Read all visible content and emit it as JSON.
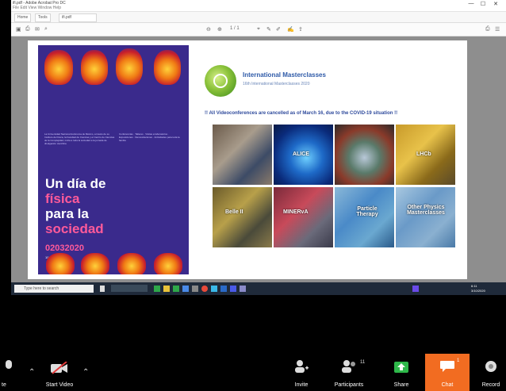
{
  "window": {
    "title": "ifi.pdf - Adobe Acrobat Pro DC",
    "menu": "File  Edit  View  Window  Help",
    "buttons": [
      "—",
      "☐",
      "✕"
    ]
  },
  "tabs": [
    {
      "label": "Home"
    },
    {
      "label": "Tools"
    },
    {
      "label": "ifi.pdf"
    }
  ],
  "toolbar": {
    "page_num": "1 / 1",
    "zoom": "☰"
  },
  "poster": {
    "intro": "La Universidad Nacional Autónoma de México, a través de su Instituto de Física, la Facultad de Ciencias y el Centro de Ciencias de la Complejidad, invita a toda la sociedad a la jornada de divulgación científica",
    "title_line1": "Un día de",
    "title_line2": "física",
    "title_line3": "para la",
    "title_line4": "sociedad",
    "date": "02032020",
    "time": "10:00",
    "details": "Conferencias · Talleres · Visitas a laboratorios · Exposiciones · Demostraciones · Actividades para toda la familia"
  },
  "masterclass": {
    "title": "International Masterclasses",
    "subtitle": "16th International Masterclasses 2020",
    "notice": "!! All Videoconferences are cancelled as of March 16, due to the COVID-19 situation !!",
    "tiles": [
      {
        "label": ""
      },
      {
        "label": "ALICE"
      },
      {
        "label": ""
      },
      {
        "label": "LHCb"
      },
      {
        "label": "Belle II"
      },
      {
        "label": "MINERvA"
      },
      {
        "label": "Particle Therapy"
      },
      {
        "label": "Other Physics Masterclasses"
      }
    ]
  },
  "taskbar": {
    "search_placeholder": "Type here to search",
    "time": "6:11",
    "date": "3/10/2020"
  },
  "zoom": {
    "audio_label": "te",
    "video_label": "Start Video",
    "invite_label": "Invite",
    "participants_label": "Participants",
    "participants_count": "11",
    "share_label": "Share",
    "chat_label": "Chat",
    "record_label": "Record",
    "chat_badge": "1",
    "colors": {
      "chat_active": "#f26c21",
      "share": "#2eb84a"
    }
  }
}
